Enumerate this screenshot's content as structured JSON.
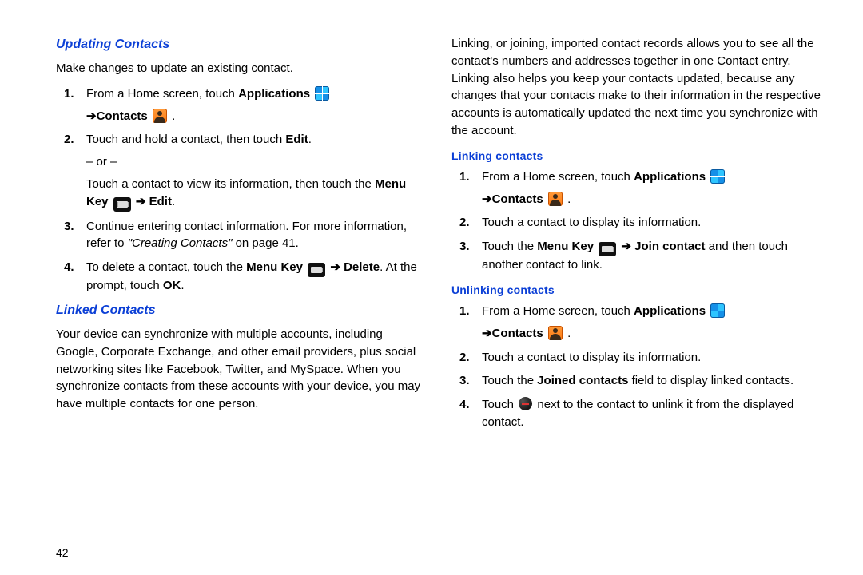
{
  "page_number": "42",
  "left": {
    "h_updating": "Updating Contacts",
    "p_update_intro": "Make changes to update an existing contact.",
    "steps_update": [
      {
        "pre": "From a Home screen, touch ",
        "bold1": "Applications",
        "sub_arrow": "➔",
        "bold2": "Contacts",
        "post": " ."
      },
      {
        "l1a": "Touch and hold a contact, then touch ",
        "l1bold": "Edit",
        "l1b": ".",
        "or": "– or –",
        "l2": "Touch a contact to view its information, then touch the ",
        "l2bold1": "Menu Key",
        "l2arrow": " ➔ ",
        "l2bold2": "Edit",
        "l2end": "."
      },
      {
        "text_a": "Continue entering contact information. For more information, refer to ",
        "ital": "\"Creating Contacts\"",
        "text_b": " on page 41."
      },
      {
        "t1": "To delete a contact, touch the ",
        "bold1": "Menu Key",
        "arrow": " ➔ ",
        "bold2": "Delete",
        "t2": ". At the prompt, touch ",
        "bold3": "OK",
        "t3": "."
      }
    ],
    "h_linked": "Linked Contacts",
    "p_linked": "Your device can synchronize with multiple accounts, including Google, Corporate Exchange, and other email providers, plus social networking sites like Facebook, Twitter, and MySpace. When you synchronize contacts from these accounts with your device, you may have multiple contacts for one person."
  },
  "right": {
    "p_intro": "Linking, or joining, imported contact records allows you to see all the contact's numbers and addresses together in one Contact entry. Linking also helps you keep your contacts updated, because any changes that your contacts make to their information in the respective accounts is automatically updated the next time you synchronize with the account.",
    "h_linking": "Linking contacts",
    "linking": {
      "s1_pre": "From a Home screen, touch ",
      "s1_bold": "Applications",
      "s1_sub_arrow": "➔",
      "s1_bold2": "Contacts",
      "s1_post": " .",
      "s2": "Touch a contact to display its information.",
      "s3_a": "Touch the ",
      "s3_bold1": "Menu Key",
      "s3_arrow": " ➔ ",
      "s3_bold2": "Join contact",
      "s3_b": " and then touch another contact to link."
    },
    "h_unlinking": "Unlinking contacts",
    "unlinking": {
      "s1_pre": "From a Home screen, touch ",
      "s1_bold": "Applications",
      "s1_sub_arrow": "➔",
      "s1_bold2": "Contacts",
      "s1_post": " .",
      "s2": "Touch a contact to display its information.",
      "s3_a": "Touch the ",
      "s3_bold": "Joined contacts",
      "s3_b": " field to display linked contacts.",
      "s4_a": "Touch ",
      "s4_b": " next to the contact to unlink it from the displayed contact."
    }
  }
}
